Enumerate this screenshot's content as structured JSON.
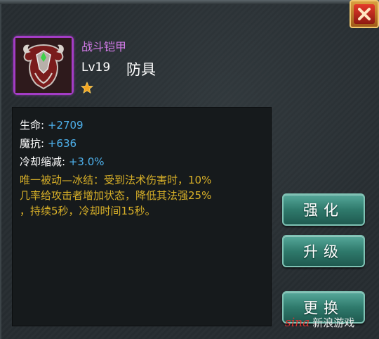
{
  "item": {
    "name": "战斗铠甲",
    "level": "Lv19",
    "type": "防具",
    "rarity_stars": 1,
    "frame_color": "#a43cc6",
    "icon": "armor-icon"
  },
  "stats": [
    {
      "label": "生命: ",
      "value": "+2709"
    },
    {
      "label": "魔抗: ",
      "value": "+636"
    },
    {
      "label": "冷却缩减: ",
      "value": "+3.0%"
    }
  ],
  "passive_text": "唯一被动—冰结：受到法术伤害时，10%\n几率给攻击者增加状态，降低其法强25%\n，持续5秒，冷却时间15秒。",
  "buttons": {
    "enhance": "强化",
    "upgrade": "升级",
    "replace": "更换"
  },
  "watermark": {
    "logo": "sina",
    "text": "新浪游戏"
  },
  "colors": {
    "name": "#d27be8",
    "stat_value": "#4eb2ee",
    "passive": "#d8b028",
    "button": "#2f7a6c"
  }
}
